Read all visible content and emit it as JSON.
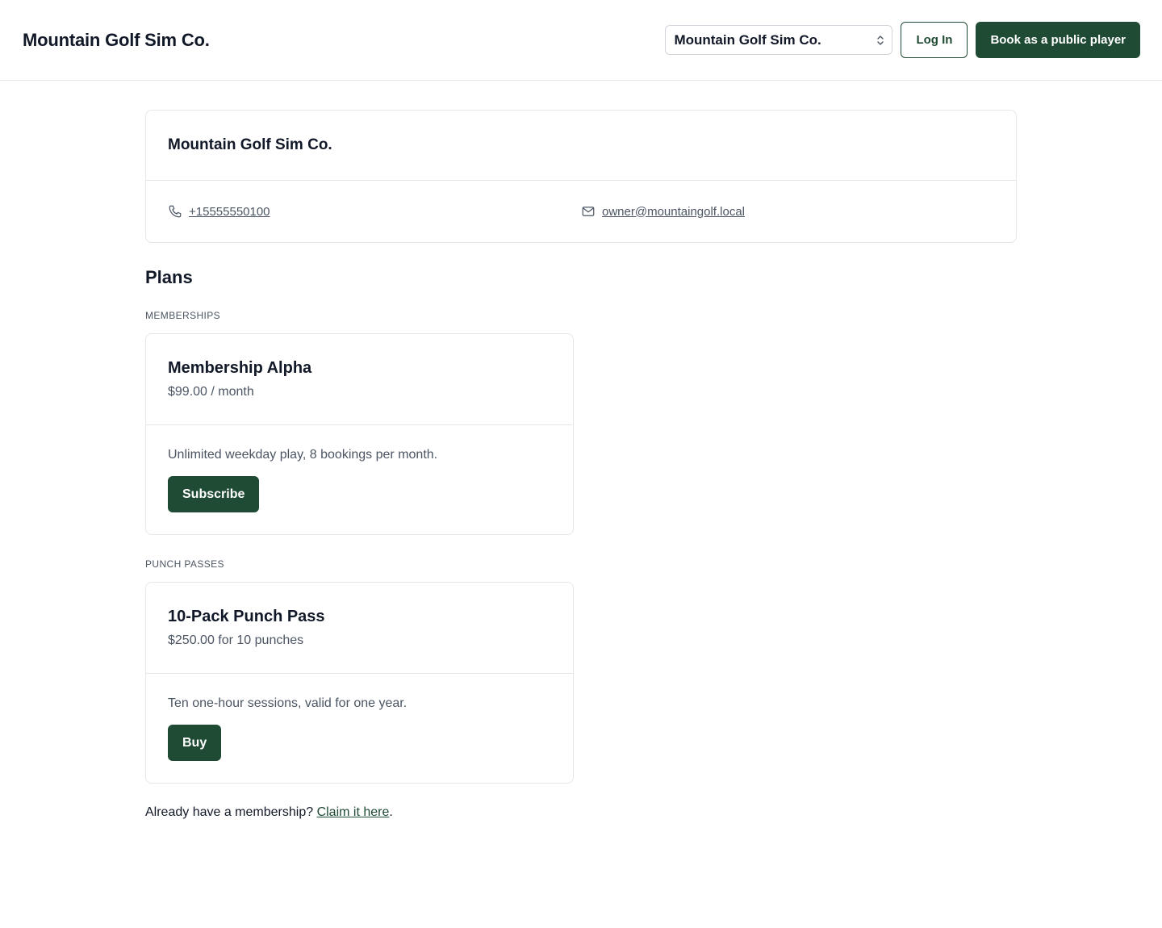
{
  "header": {
    "brand": "Mountain Golf Sim Co.",
    "venue_select_value": "Mountain Golf Sim Co.",
    "login_label": "Log In",
    "public_booking_label": "Book as a public player"
  },
  "venue": {
    "name": "Mountain Golf Sim Co.",
    "phone": "+15555550100",
    "email": "owner@mountaingolf.local"
  },
  "plans": {
    "title": "Plans",
    "memberships_label": "MEMBERSHIPS",
    "punch_passes_label": "PUNCH PASSES",
    "membership": {
      "name": "Membership Alpha",
      "price": "$99.00 / month",
      "description": "Unlimited weekday play, 8 bookings per month.",
      "button_label": "Subscribe"
    },
    "punch_pass": {
      "name": "10-Pack Punch Pass",
      "price": "$250.00 for 10 punches",
      "description": "Ten one-hour sessions, valid for one year.",
      "button_label": "Buy"
    }
  },
  "claim": {
    "prefix": "Already have a membership? ",
    "link_label": "Claim it here",
    "suffix": "."
  },
  "colors": {
    "accent": "#1f4a33",
    "border": "#e5e7eb",
    "muted_text": "#4b5563"
  },
  "icons": {
    "phone": "phone-icon",
    "email": "mail-icon",
    "select_chevron": "chevron-up-down-icon"
  }
}
